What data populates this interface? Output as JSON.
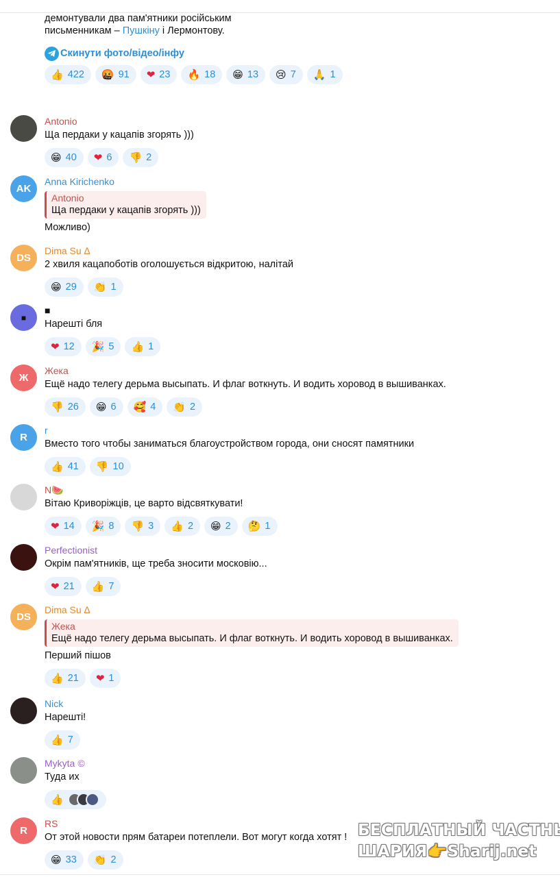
{
  "post": {
    "text_line1": "демонтували два пам'ятники російським",
    "text_line2_pre": "письменникам – ",
    "link1": "Пушкіну",
    "text_line2_mid": " і Лермонтову.",
    "share_label": "Скинути фото/відео/інфу",
    "reactions": [
      {
        "emoji": "👍",
        "count": "422"
      },
      {
        "emoji": "🤬",
        "count": "91"
      },
      {
        "emoji": "❤",
        "count": "23"
      },
      {
        "emoji": "🔥",
        "count": "18"
      },
      {
        "emoji": "😁",
        "count": "13"
      },
      {
        "emoji": "😢",
        "count": "7"
      },
      {
        "emoji": "🙏",
        "count": "1"
      }
    ]
  },
  "comments": [
    {
      "author": "Antonio",
      "author_color": "#c6504a",
      "avatar_text": "",
      "avatar_bg": "#4a4a44",
      "text": "Ща пердаки у кацапів згорять )))",
      "reactions": [
        {
          "emoji": "😁",
          "count": "40"
        },
        {
          "emoji": "❤",
          "count": "6"
        },
        {
          "emoji": "👎",
          "count": "2"
        }
      ]
    },
    {
      "author": "Anna Kirichenko",
      "author_color": "#3a8fd0",
      "avatar_text": "AK",
      "avatar_bg": "#4aa3e8",
      "quote_author": "Antonio",
      "quote_text": "Ща пердаки у кацапів згорять )))",
      "text": "Можливо)",
      "reactions": []
    },
    {
      "author": "Dima Su",
      "author_badge": "∆",
      "author_color": "#e08a30",
      "avatar_text": "DS",
      "avatar_bg": "#f5b05a",
      "text": "2 хвиля кацапоботів оголошується відкритою, налітай",
      "reactions": [
        {
          "emoji": "😁",
          "count": "29"
        },
        {
          "emoji": "👏",
          "count": "1"
        }
      ]
    },
    {
      "author": "■",
      "author_color": "#111111",
      "avatar_text": "■",
      "avatar_bg": "#6b6be0",
      "text": "Нарешті бля",
      "reactions": [
        {
          "emoji": "❤",
          "count": "12"
        },
        {
          "emoji": "🎉",
          "count": "5"
        },
        {
          "emoji": "👍",
          "count": "1"
        }
      ]
    },
    {
      "author": "Жека",
      "author_color": "#c6504a",
      "avatar_text": "Ж",
      "avatar_bg": "#ee6a6a",
      "text": "Ещё надо телегу дерьма высыпать. И флаг воткнуть. И водить хоровод в вышиванках.",
      "reactions": [
        {
          "emoji": "👎",
          "count": "26"
        },
        {
          "emoji": "😁",
          "count": "6"
        },
        {
          "emoji": "🥰",
          "count": "4"
        },
        {
          "emoji": "👏",
          "count": "2"
        }
      ]
    },
    {
      "author": "r",
      "author_color": "#3a8fd0",
      "avatar_text": "R",
      "avatar_bg": "#4aa3e8",
      "text": "Вместо того чтобы заниматься благоустройством города, они сносят памятники",
      "reactions": [
        {
          "emoji": "👍",
          "count": "41"
        },
        {
          "emoji": "👎",
          "count": "10"
        }
      ]
    },
    {
      "author": "N🍉",
      "author_color": "#c6504a",
      "avatar_text": "",
      "avatar_bg": "#d8d8d8",
      "text": "Вітаю Криворіжців, це варто відсвяткувати!",
      "reactions": [
        {
          "emoji": "❤",
          "count": "14"
        },
        {
          "emoji": "🎉",
          "count": "8"
        },
        {
          "emoji": "👎",
          "count": "3"
        },
        {
          "emoji": "👍",
          "count": "2"
        },
        {
          "emoji": "😁",
          "count": "2"
        },
        {
          "emoji": "🤔",
          "count": "1"
        }
      ]
    },
    {
      "author": "Perfectionist",
      "author_color": "#9a5fc6",
      "avatar_text": "",
      "avatar_bg": "#3a1210",
      "text": "Окрім пам'ятників, ще треба зносити московію...",
      "reactions": [
        {
          "emoji": "❤",
          "count": "21"
        },
        {
          "emoji": "👍",
          "count": "7"
        }
      ]
    },
    {
      "author": "Dima Su",
      "author_badge": "∆",
      "author_color": "#e08a30",
      "avatar_text": "DS",
      "avatar_bg": "#f5b05a",
      "quote_author": "Жека",
      "quote_text": "Ещё надо телегу дерьма высыпать. И флаг воткнуть. И водить хоровод в вышиванках.",
      "text": "Перший пішов",
      "reactions": [
        {
          "emoji": "👍",
          "count": "21"
        },
        {
          "emoji": "❤",
          "count": "1"
        }
      ]
    },
    {
      "author": "Nick",
      "author_color": "#3a8fd0",
      "avatar_text": "",
      "avatar_bg": "#2a2020",
      "text": "Нарешті!",
      "reactions": [
        {
          "emoji": "👍",
          "count": "7"
        }
      ]
    },
    {
      "author": "Mykyta",
      "author_badge": "©",
      "author_color": "#9a5fc6",
      "avatar_text": "",
      "avatar_bg": "#8a8f8a",
      "text": "Туда их",
      "reactions": [
        {
          "emoji": "👍",
          "count": ""
        }
      ]
    },
    {
      "author": "RS",
      "author_color": "#c6504a",
      "avatar_text": "R",
      "avatar_bg": "#ee6a6a",
      "text": "От этой новости прям батареи потеплели. Вот могут когда хотят !",
      "reactions": [
        {
          "emoji": "😁",
          "count": "33"
        },
        {
          "emoji": "👏",
          "count": "2"
        }
      ]
    }
  ],
  "watermark": {
    "line1": "БЕСПЛАТНЫЙ ЧАСТНЫЙ",
    "line2": "ШАРИЯ👉Sharij.net"
  }
}
